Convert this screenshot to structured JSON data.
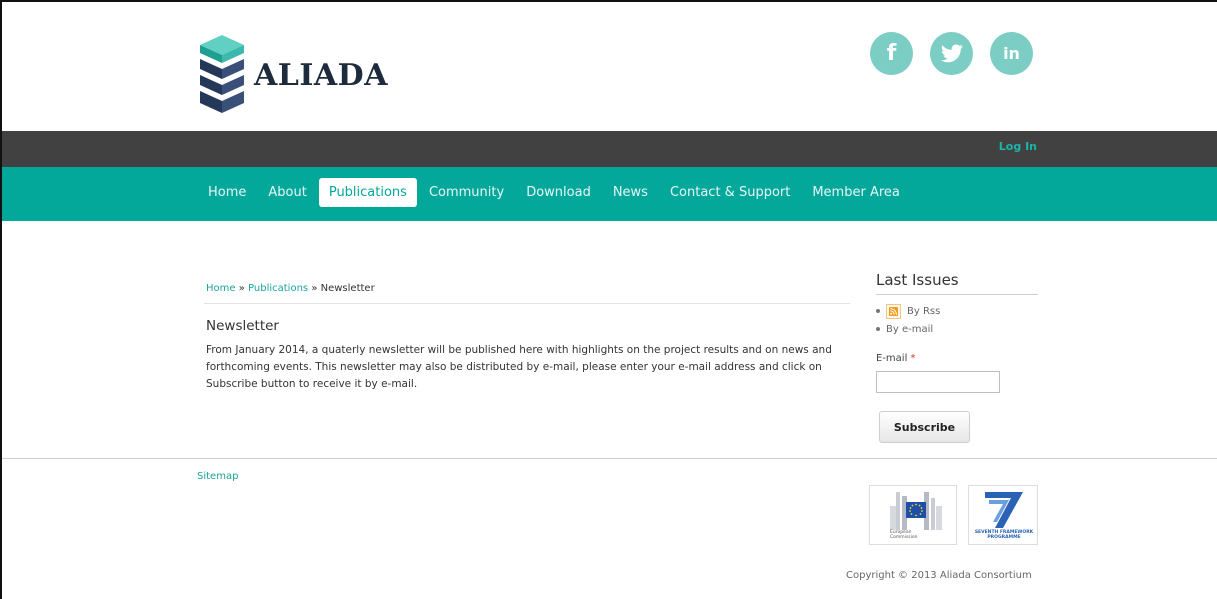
{
  "brand": {
    "name": "ALIADA"
  },
  "social": [
    {
      "name": "facebook-icon",
      "glyph": "f"
    },
    {
      "name": "twitter-icon",
      "glyph": "t"
    },
    {
      "name": "linkedin-icon",
      "glyph": "in"
    }
  ],
  "topbar": {
    "login": "Log In"
  },
  "nav": {
    "items": [
      "Home",
      "About",
      "Publications",
      "Community",
      "Download",
      "News",
      "Contact & Support",
      "Member Area"
    ],
    "active": "Publications"
  },
  "breadcrumb": {
    "home": "Home",
    "sep": "»",
    "section": "Publications",
    "current": "Newsletter"
  },
  "main": {
    "title": "Newsletter",
    "body": "From January 2014, a quaterly newsletter will be published here with highlights on the project results and on news and forthcoming events. This newsletter may also be distributed by e-mail, please enter your e-mail address and click on Subscribe button to receive it by e-mail."
  },
  "sidebar": {
    "title": "Last Issues",
    "items": [
      "By Rss",
      "By e-mail"
    ],
    "email_label": "E-mail",
    "required_mark": "*",
    "email_value": "",
    "subscribe": "Subscribe"
  },
  "footer": {
    "sitemap": "Sitemap",
    "eu_text_1": "European",
    "eu_text_2": "Commission",
    "fp7_text_1": "SEVENTH FRAMEWORK",
    "fp7_text_2": "PROGRAMME",
    "copyright": "Copyright © 2013 Aliada Consortium"
  },
  "colors": {
    "teal": "#03a89b",
    "dark_bar": "#414141",
    "social": "#7ccdc4",
    "link": "#19a59a"
  }
}
